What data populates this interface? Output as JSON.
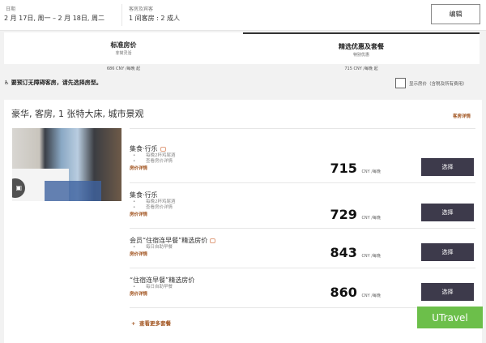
{
  "header": {
    "date_label": "日期",
    "date_value": "2 月 17日, 周一 – 2 月 18日, 周二",
    "guests_label": "客房及宾客",
    "guests_value": "1 间客房 : 2 成人",
    "edit_label": "编辑"
  },
  "tabs": [
    {
      "title": "标准房价",
      "subtitle": "非常灵活",
      "price": "686 CNY /每晚 起",
      "active": false
    },
    {
      "title": "精选优惠及套餐",
      "subtitle": "特别优惠",
      "price": "715 CNY /每晚 起",
      "active": true
    }
  ],
  "accessible_notice": "要预订无障碍客房，请先选择房型。",
  "show_total_label": "显示房价（含税及所有费用）",
  "room": {
    "title": "豪华, 客房, 1 张特大床, 城市景观",
    "details_link": "客房详情",
    "rates": [
      {
        "name": "集食·行乐",
        "tag": true,
        "bullets": [
          "每晚2杯鸡尾酒",
          "查看房价详情"
        ],
        "details": "房价详情",
        "price": "715",
        "unit": "CNY /每晚",
        "button": "选择"
      },
      {
        "name": "集食·行乐",
        "tag": false,
        "bullets": [
          "每晚2杯鸡尾酒",
          "查看房价详情"
        ],
        "details": "房价详情",
        "price": "729",
        "unit": "CNY /每晚",
        "button": "选择"
      },
      {
        "name": "会员“住宿连早餐”精选房价",
        "tag": true,
        "bullets": [
          "每日自助早餐"
        ],
        "details": "房价详情",
        "price": "843",
        "unit": "CNY /每晚",
        "button": "选择"
      },
      {
        "name": "“住宿连早餐”精选房价",
        "tag": false,
        "bullets": [
          "每日自助早餐"
        ],
        "details": "房价详情",
        "price": "860",
        "unit": "CNY /每晚",
        "button": "选择"
      }
    ],
    "more_label": "查看更多套餐"
  },
  "watermark": "UTravel"
}
